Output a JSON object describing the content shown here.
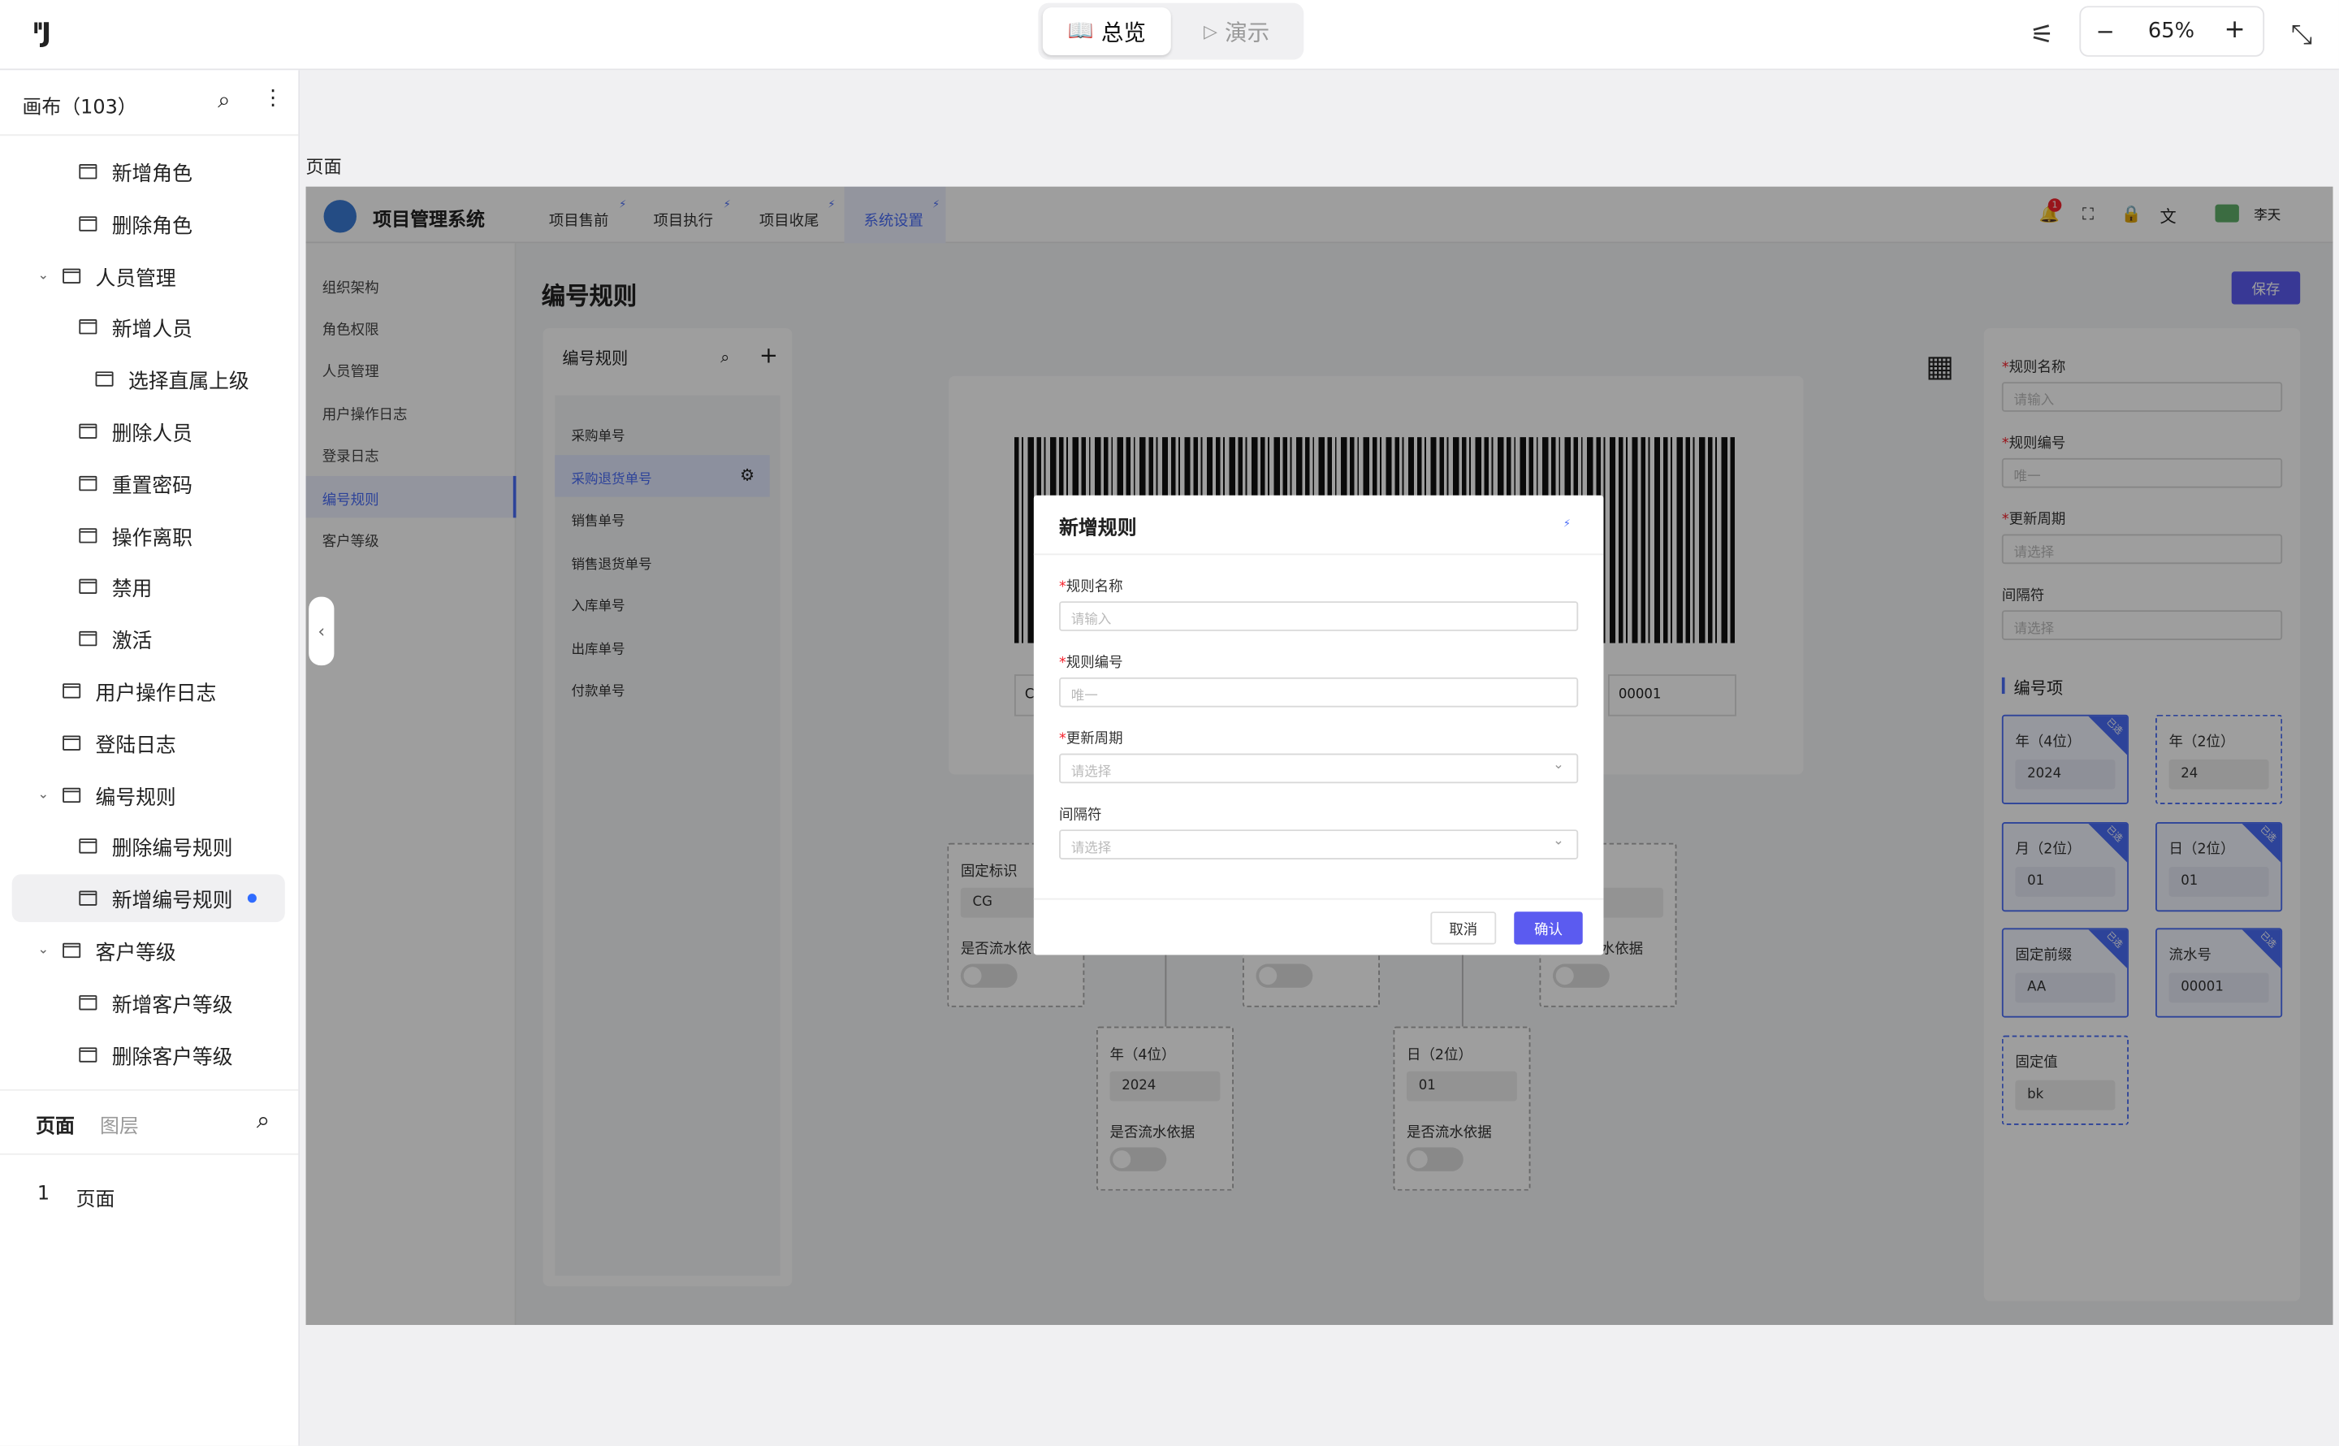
{
  "toolbar": {
    "logo": "ᴵ'J",
    "overview_label": "总览",
    "present_label": "演示",
    "zoom_value": "65%"
  },
  "sidebar": {
    "title": "画布（103）",
    "items": [
      {
        "label": "新增角色"
      },
      {
        "label": "删除角色"
      },
      {
        "label": "人员管理"
      },
      {
        "label": "新增人员"
      },
      {
        "label": "选择直属上级"
      },
      {
        "label": "删除人员"
      },
      {
        "label": "重置密码"
      },
      {
        "label": "操作离职"
      },
      {
        "label": "禁用"
      },
      {
        "label": "激活"
      },
      {
        "label": "用户操作日志"
      },
      {
        "label": "登陆日志"
      },
      {
        "label": "编号规则"
      },
      {
        "label": "删除编号规则"
      },
      {
        "label": "新增编号规则"
      },
      {
        "label": "客户等级"
      },
      {
        "label": "新增客户等级"
      },
      {
        "label": "删除客户等级"
      }
    ],
    "bottom_tabs": {
      "pages": "页面",
      "layers": "图层"
    },
    "page_list": [
      {
        "index": "1",
        "name": "页面"
      }
    ]
  },
  "canvas": {
    "frame_label": "页面"
  },
  "app": {
    "title": "项目管理系统",
    "nav": [
      "项目售前",
      "项目执行",
      "项目收尾",
      "系统设置"
    ],
    "badge": "1",
    "user": "李天",
    "side": [
      "组织架构",
      "角色权限",
      "人员管理",
      "用户操作日志",
      "登录日志",
      "编号规则",
      "客户等级"
    ],
    "page_title": "编号规则",
    "save": "保存",
    "list_title": "编号规则",
    "list": [
      "采购单号",
      "采购退货单号",
      "销售单号",
      "销售退货单号",
      "入库单号",
      "出库单号",
      "付款单号"
    ],
    "barcode_fields": [
      "C",
      "00001"
    ],
    "nodes": {
      "fixed_label": "固定标识",
      "fixed_value": "CG",
      "serial_basis": "是否流水依据",
      "serial_basis_partial": "是否流水依",
      "serial_basis_partial2": "水依据",
      "year_label": "年（4位）",
      "year_value": "2024",
      "day_label": "日（2位）",
      "day_value": "01",
      "tail_value": "1"
    },
    "form": {
      "name_label": "规则名称",
      "name_placeholder": "请输入",
      "code_label": "规则编号",
      "code_placeholder": "唯一",
      "cycle_label": "更新周期",
      "cycle_placeholder": "请选择",
      "sep_label": "间隔符",
      "sep_placeholder": "请选择",
      "items_title": "编号项"
    },
    "items": [
      {
        "label": "年（4位）",
        "value": "2024",
        "tag": "已选"
      },
      {
        "label": "年（2位）",
        "value": "24",
        "tag": ""
      },
      {
        "label": "月（2位）",
        "value": "01",
        "tag": "已选"
      },
      {
        "label": "日（2位）",
        "value": "01",
        "tag": "已选"
      },
      {
        "label": "固定前缀",
        "value": "AA",
        "tag": "已选"
      },
      {
        "label": "流水号",
        "value": "00001",
        "tag": "已选"
      },
      {
        "label": "固定值",
        "value": "bk",
        "tag": ""
      }
    ]
  },
  "modal": {
    "title": "新增规则",
    "name_label": "规则名称",
    "name_placeholder": "请输入",
    "code_label": "规则编号",
    "code_placeholder": "唯一",
    "cycle_label": "更新周期",
    "cycle_placeholder": "请选择",
    "sep_label": "间隔符",
    "sep_placeholder": "请选择",
    "cancel": "取消",
    "confirm": "确认"
  },
  "colors": {
    "accent": "#4a6cf7",
    "primary_btn": "#5b5bf0",
    "dot": "#2f6bff"
  }
}
